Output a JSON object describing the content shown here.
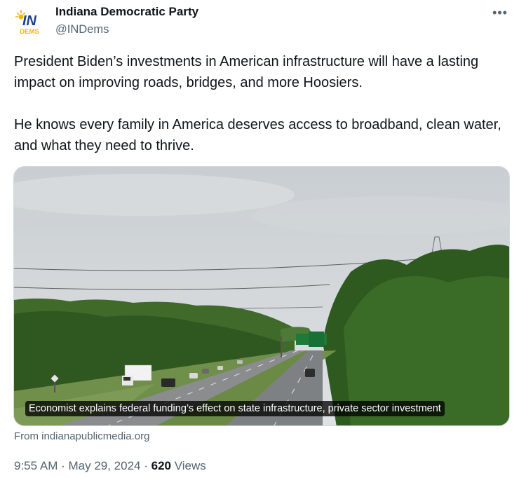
{
  "author": {
    "name": "Indiana Democratic Party",
    "handle": "@INDems",
    "avatar_text_top": "IN",
    "avatar_text_bottom": "DEMS"
  },
  "tweet": {
    "paragraphs": [
      "President Biden’s investments in American infrastructure will have a lasting impact on improving roads, bridges, and more Hoosiers.",
      "He knows every family in America deserves access to broadband, clean water, and what they need to thrive."
    ]
  },
  "card": {
    "caption": "Economist explains federal funding’s effect on state infrastructure, private sector investment",
    "source": "From indianapublicmedia.org",
    "image_icon": "highway-photo"
  },
  "meta": {
    "time": "9:55 AM",
    "separator": " · ",
    "date": "May 29, 2024",
    "views_count": "620",
    "views_label": " Views"
  },
  "icons": {
    "more": "more-dots-icon"
  },
  "colors": {
    "text_primary": "#0f1419",
    "text_secondary": "#536471",
    "border": "#cfd9de",
    "logo_blue": "#1d3f8f",
    "logo_gold": "#f2b705"
  }
}
